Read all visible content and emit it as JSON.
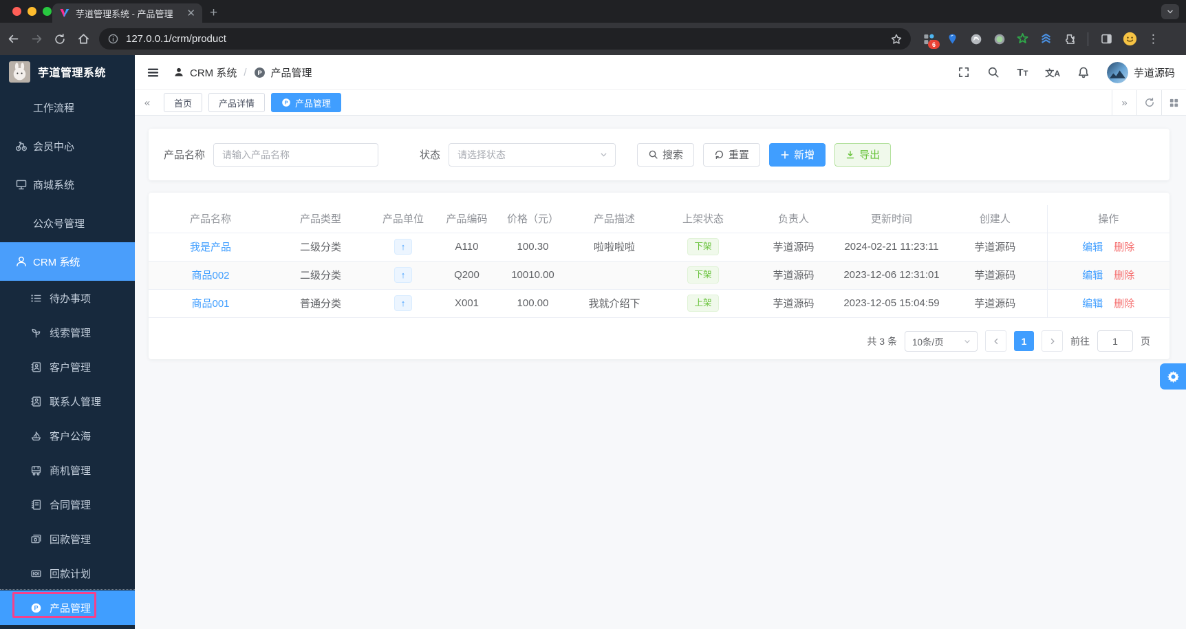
{
  "browser": {
    "tab_title": "芋道管理系统 - 产品管理",
    "url": "127.0.0.1/crm/product",
    "ext_badge": "6"
  },
  "sidebar": {
    "logo_title": "芋道管理系统",
    "top_items": [
      {
        "label": "工作流程",
        "icon": "",
        "active": false
      },
      {
        "label": "会员中心",
        "icon": "member-icon",
        "active": false
      },
      {
        "label": "商城系统",
        "icon": "mall-icon",
        "active": false
      },
      {
        "label": "公众号管理",
        "icon": "",
        "active": false
      },
      {
        "label": "CRM 系统",
        "icon": "user-icon",
        "active": true
      }
    ],
    "crm_children": [
      {
        "label": "待办事项",
        "icon": "todo-icon",
        "active": false
      },
      {
        "label": "线索管理",
        "icon": "clue-icon",
        "active": false
      },
      {
        "label": "客户管理",
        "icon": "customer-icon",
        "active": false
      },
      {
        "label": "联系人管理",
        "icon": "contact-icon",
        "active": false
      },
      {
        "label": "客户公海",
        "icon": "pool-icon",
        "active": false
      },
      {
        "label": "商机管理",
        "icon": "business-icon",
        "active": false
      },
      {
        "label": "合同管理",
        "icon": "contract-icon",
        "active": false
      },
      {
        "label": "回款管理",
        "icon": "receivable-icon",
        "active": false
      },
      {
        "label": "回款计划",
        "icon": "plan-icon",
        "active": false
      },
      {
        "label": "产品管理",
        "icon": "product-icon",
        "active": true
      }
    ]
  },
  "header": {
    "breadcrumb_root": "CRM 系统",
    "breadcrumb_sep": "/",
    "breadcrumb_current": "产品管理",
    "username": "芋道源码"
  },
  "tabs": [
    {
      "label": "首页",
      "active": false
    },
    {
      "label": "产品详情",
      "active": false
    },
    {
      "label": "产品管理",
      "active": true
    }
  ],
  "filter": {
    "name_label": "产品名称",
    "name_placeholder": "请输入产品名称",
    "status_label": "状态",
    "status_placeholder": "请选择状态",
    "search_label": "搜索",
    "reset_label": "重置",
    "create_label": "新增",
    "export_label": "导出"
  },
  "table": {
    "columns": [
      "产品名称",
      "产品类型",
      "产品单位",
      "产品编码",
      "价格（元）",
      "产品描述",
      "上架状态",
      "负责人",
      "更新时间",
      "创建人",
      "操作"
    ],
    "unit_glyph": "↑",
    "edit_label": "编辑",
    "delete_label": "删除",
    "rows": [
      {
        "name": "我是产品",
        "type": "二级分类",
        "code": "A110",
        "price": "100.30",
        "desc": "啦啦啦啦",
        "status": "下架",
        "owner": "芋道源码",
        "updated": "2024-02-21 11:23:11",
        "creator": "芋道源码"
      },
      {
        "name": "商品002",
        "type": "二级分类",
        "code": "Q200",
        "price": "10010.00",
        "desc": "",
        "status": "下架",
        "owner": "芋道源码",
        "updated": "2023-12-06 12:31:01",
        "creator": "芋道源码"
      },
      {
        "name": "商品001",
        "type": "普通分类",
        "code": "X001",
        "price": "100.00",
        "desc": "我就介绍下",
        "status": "上架",
        "owner": "芋道源码",
        "updated": "2023-12-05 15:04:59",
        "creator": "芋道源码"
      }
    ]
  },
  "pagination": {
    "total": "共 3 条",
    "page_size": "10条/页",
    "current_page": "1",
    "goto_label": "前往",
    "goto_value": "1",
    "page_unit": "页"
  },
  "colors": {
    "primary": "#409eff",
    "success": "#67c23a",
    "danger": "#f56c6c",
    "sidebar_bg": "#17293d",
    "highlight_box": "#f5418b"
  }
}
